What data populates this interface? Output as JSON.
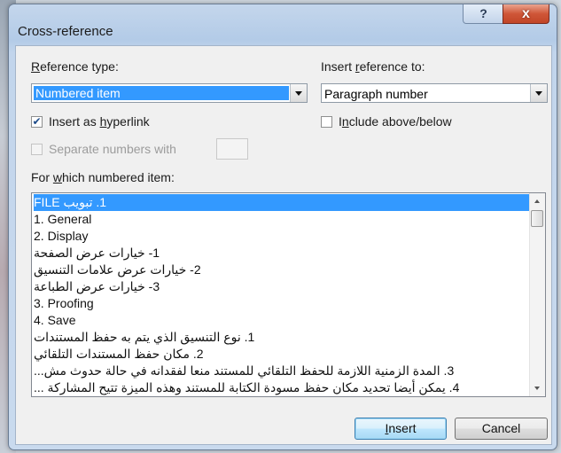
{
  "dialog": {
    "title": "Cross-reference",
    "help_button": "?",
    "close_button": "x"
  },
  "reference_type": {
    "label": "Reference type:",
    "selected": "Numbered item"
  },
  "insert_reference_to": {
    "label": "Insert reference to:",
    "selected": "Paragraph number"
  },
  "insert_as_hyperlink": {
    "label": "Insert as hyperlink",
    "checked": true
  },
  "include_above_below": {
    "label": "Include above/below",
    "checked": false
  },
  "separate_numbers": {
    "label": "Separate numbers with",
    "checked": false,
    "enabled": false,
    "value": ""
  },
  "items_list": {
    "label": "For which numbered item:",
    "items": [
      "1. تبويب FILE",
      "1. General",
      "2. Display",
      "1- خيارات عرض الصفحة",
      "2- خيارات عرض علامات  التنسيق",
      "3- خيارات عرض الطباعة",
      "3. Proofing",
      "4. Save",
      "1. نوع التنسيق الذي يتم به حفظ المستندات",
      "2. مكان حفظ المستندات التلقائي",
      "3. المدة الزمنية اللازمة للحفظ التلقائي للمستند منعا لفقدانه في حالة حدوث مش...",
      "4. يمكن أيضا تحديد مكان حفظ مسودة الكتابة للمستند وهذه الميزة تتيح المشاركة ..."
    ],
    "selected_index": 0
  },
  "buttons": {
    "insert": "Insert",
    "cancel": "Cancel"
  }
}
